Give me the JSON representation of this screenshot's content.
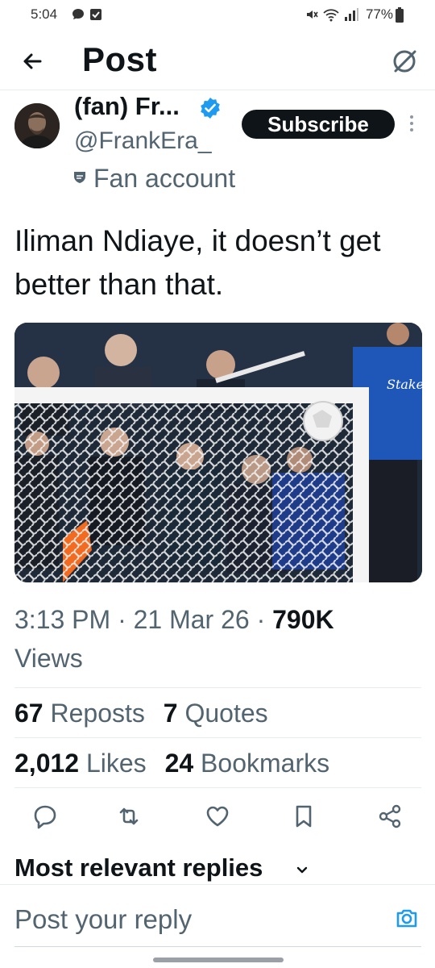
{
  "status_bar": {
    "time": "5:04",
    "battery": "77%"
  },
  "header": {
    "title": "Post"
  },
  "author": {
    "display_name": "(fan) Fr...",
    "handle": "@FrankEra_",
    "badge_label": "Fan account",
    "subscribe_label": "Subscribe"
  },
  "tweet": {
    "text": "Iliman Ndiaye, it doesn’t get better than that."
  },
  "meta": {
    "time": "3:13 PM",
    "date": "21 Mar 26",
    "views_count": "790K",
    "views_label": "Views"
  },
  "stats": {
    "reposts_count": "67",
    "reposts_label": "Reposts",
    "quotes_count": "7",
    "quotes_label": "Quotes",
    "likes_count": "2,012",
    "likes_label": "Likes",
    "bookmarks_count": "24",
    "bookmarks_label": "Bookmarks"
  },
  "replies": {
    "title": "Most relevant replies"
  },
  "composer": {
    "placeholder": "Post your reply"
  },
  "colors": {
    "text_primary": "#0f1419",
    "text_secondary": "#536471",
    "verified": "#1d9bf0",
    "subscribe_bg": "#0f1419"
  }
}
